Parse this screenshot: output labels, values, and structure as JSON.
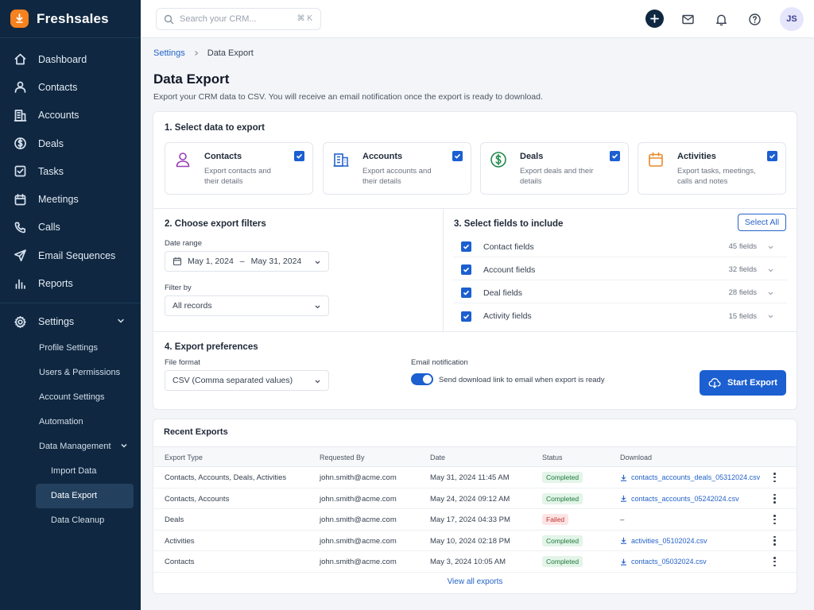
{
  "app": {
    "name": "Freshsales"
  },
  "sidebar": {
    "items": [
      {
        "label": "Dashboard",
        "icon": "home-icon"
      },
      {
        "label": "Contacts",
        "icon": "user-icon"
      },
      {
        "label": "Accounts",
        "icon": "building-icon"
      },
      {
        "label": "Deals",
        "icon": "dollar-icon"
      },
      {
        "label": "Tasks",
        "icon": "checkbox-icon"
      },
      {
        "label": "Meetings",
        "icon": "calendar-icon"
      },
      {
        "label": "Calls",
        "icon": "phone-icon"
      },
      {
        "label": "Email Sequences",
        "icon": "send-icon"
      },
      {
        "label": "Reports",
        "icon": "bar-chart-icon"
      }
    ],
    "settings": {
      "label": "Settings",
      "icon": "gear-icon"
    },
    "sub_items": [
      "Profile Settings",
      "Users & Permissions",
      "Account Settings",
      "Automation",
      "Data Management"
    ],
    "data_mgmt_items": [
      "Import Data",
      "Data Export",
      "Data Cleanup"
    ],
    "active": "Data Export"
  },
  "topbar": {
    "search_placeholder": "Search your CRM...",
    "shortcut": "⌘ K",
    "avatar_initials": "JS"
  },
  "breadcrumb": {
    "parent": "Settings",
    "current": "Data Export"
  },
  "page": {
    "title": "Data Export",
    "subtitle": "Export your CRM data to CSV. You will receive an email notification once the export is ready to download."
  },
  "section1": {
    "title": "1. Select data to export",
    "types": [
      {
        "title": "Contacts",
        "desc": "Export contacts and their details",
        "checked": true,
        "icon": "person-icon",
        "color": "#9b3fb8"
      },
      {
        "title": "Accounts",
        "desc": "Export accounts and their details",
        "checked": true,
        "icon": "building-icon",
        "color": "#2563c9"
      },
      {
        "title": "Deals",
        "desc": "Export deals and their details",
        "checked": true,
        "icon": "dollar-circle-icon",
        "color": "#1f8a4c"
      },
      {
        "title": "Activities",
        "desc": "Export tasks, meetings, calls and notes",
        "checked": true,
        "icon": "calendar-icon",
        "color": "#e98a2a"
      }
    ]
  },
  "section2": {
    "title": "2. Choose export filters",
    "date_label": "Date range",
    "date_start": "May 1, 2024",
    "date_sep": "–",
    "date_end": "May 31, 2024",
    "filter_label": "Filter by",
    "filter_value": "All records"
  },
  "section3": {
    "title": "3. Select fields to include",
    "select_all": "Select All",
    "fields": [
      {
        "name": "Contact fields",
        "count": "45 fields",
        "checked": true
      },
      {
        "name": "Account fields",
        "count": "32 fields",
        "checked": true
      },
      {
        "name": "Deal fields",
        "count": "28 fields",
        "checked": true
      },
      {
        "name": "Activity fields",
        "count": "15 fields",
        "checked": true
      }
    ]
  },
  "section4": {
    "title": "4. Export preferences",
    "format_label": "File format",
    "format_value": "CSV (Comma separated values)",
    "email_label": "Email notification",
    "email_toggle": true,
    "email_text": "Send download link to email when export is ready",
    "start_button": "Start Export"
  },
  "recent": {
    "title": "Recent Exports",
    "columns": [
      "Export Type",
      "Requested By",
      "Date",
      "Status",
      "Download"
    ],
    "rows": [
      {
        "type": "Contacts, Accounts, Deals, Activities",
        "by": "john.smith@acme.com",
        "date": "May 31, 2024  11:45 AM",
        "status": "Completed",
        "file": "contacts_accounts_deals_05312024.csv"
      },
      {
        "type": "Contacts, Accounts",
        "by": "john.smith@acme.com",
        "date": "May 24, 2024  09:12 AM",
        "status": "Completed",
        "file": "contacts_accounts_05242024.csv"
      },
      {
        "type": "Deals",
        "by": "john.smith@acme.com",
        "date": "May 17, 2024  04:33 PM",
        "status": "Failed",
        "file": "–"
      },
      {
        "type": "Activities",
        "by": "john.smith@acme.com",
        "date": "May 10, 2024  02:18 PM",
        "status": "Completed",
        "file": "activities_05102024.csv"
      },
      {
        "type": "Contacts",
        "by": "john.smith@acme.com",
        "date": "May 3, 2024  10:05 AM",
        "status": "Completed",
        "file": "contacts_05032024.csv"
      }
    ],
    "view_all": "View all exports"
  },
  "colors": {
    "sidebar_bg": "#0f2740",
    "primary": "#1b5fd1",
    "brand": "#f5821f"
  }
}
